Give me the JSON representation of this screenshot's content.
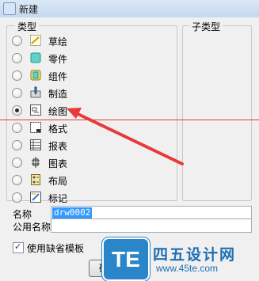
{
  "window": {
    "title": "新建"
  },
  "type_group": {
    "legend": "类型",
    "items": [
      {
        "label": "草绘",
        "icon": "sketch-icon",
        "checked": false
      },
      {
        "label": "零件",
        "icon": "part-icon",
        "checked": false
      },
      {
        "label": "组件",
        "icon": "assembly-icon",
        "checked": false
      },
      {
        "label": "制造",
        "icon": "manufacturing-icon",
        "checked": false
      },
      {
        "label": "绘图",
        "icon": "drawing-icon",
        "checked": true
      },
      {
        "label": "格式",
        "icon": "format-icon",
        "checked": false
      },
      {
        "label": "报表",
        "icon": "report-icon",
        "checked": false
      },
      {
        "label": "图表",
        "icon": "diagram-icon",
        "checked": false
      },
      {
        "label": "布局",
        "icon": "layout-icon",
        "checked": false
      },
      {
        "label": "标记",
        "icon": "markup-icon",
        "checked": false
      }
    ]
  },
  "subtype_group": {
    "legend": "子类型"
  },
  "name_field": {
    "label": "名称",
    "value": "drw0002"
  },
  "common_name_field": {
    "label": "公用名称",
    "value": ""
  },
  "default_template": {
    "label": "使用缺省模板",
    "checked": true
  },
  "ok_button": {
    "label": "确定"
  },
  "watermark": {
    "badge": "TE",
    "title": "四五设计网",
    "url": "www.45te.com"
  },
  "colors": {
    "annotation_red": "#e83a3a",
    "selection_blue": "#3399ff",
    "brand_blue": "#1d6fb3"
  }
}
